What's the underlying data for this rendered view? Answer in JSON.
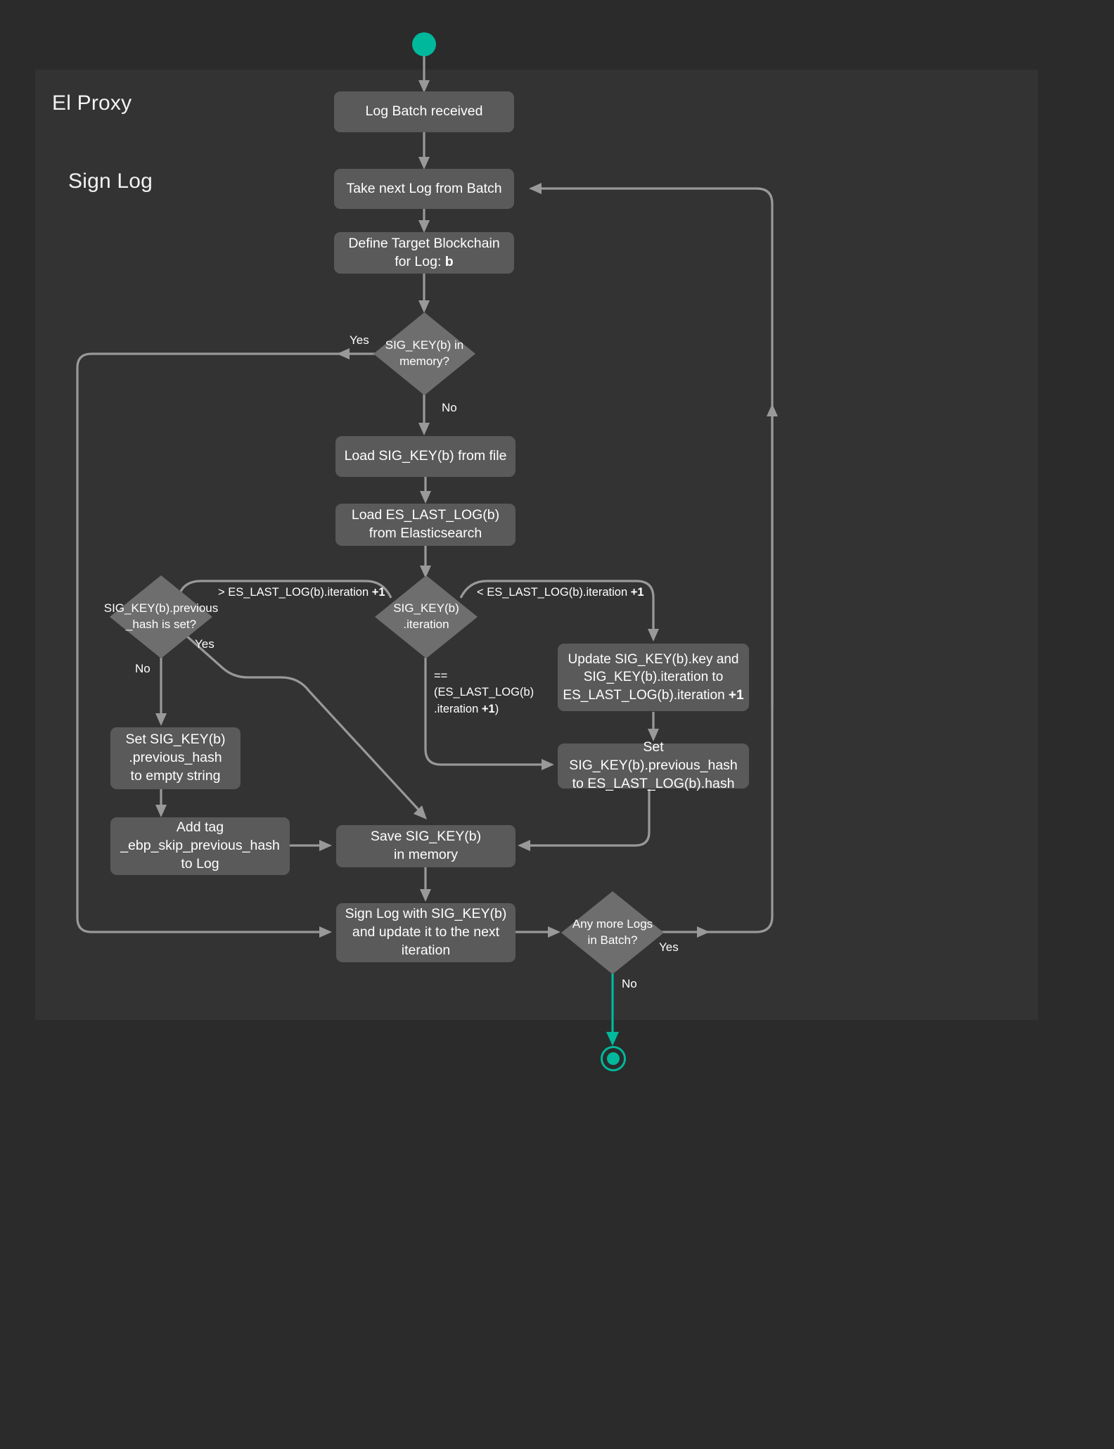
{
  "diagram": {
    "title": "El Proxy Sign Log flowchart",
    "colors": {
      "background": "#2b2b2b",
      "subgraph": "#333333",
      "node": "#5a5a5a",
      "diamond": "#6e6e6e",
      "edge": "#999999",
      "terminator": "#00b89c",
      "text": "#ffffff"
    },
    "subgraphs": [
      {
        "id": "el-proxy",
        "label": "El Proxy"
      },
      {
        "id": "sign-log",
        "label": "Sign Log"
      }
    ],
    "terminators": {
      "start": "start-node",
      "end": "end-node"
    },
    "nodes": [
      {
        "id": "log-batch-received",
        "label": "Log Batch received"
      },
      {
        "id": "take-next-log",
        "label": "Take next Log from Batch"
      },
      {
        "id": "define-target",
        "label": "Define Target Blockchain\nfor Log: b"
      },
      {
        "id": "load-sig-key",
        "label": "Load SIG_KEY(b) from file"
      },
      {
        "id": "load-es-last-log",
        "label": "Load ES_LAST_LOG(b)\nfrom Elasticsearch"
      },
      {
        "id": "update-sig-key",
        "label": "Update SIG_KEY(b).key and\nSIG_KEY(b).iteration to\nES_LAST_LOG(b).iteration +1"
      },
      {
        "id": "set-prev-hash-empty",
        "label": "Set SIG_KEY(b)\n.previous_hash\nto empty string"
      },
      {
        "id": "set-prev-hash-es",
        "label": "Set SIG_KEY(b).previous_hash\nto ES_LAST_LOG(b).hash"
      },
      {
        "id": "add-tag",
        "label": "Add tag\n_ebp_skip_previous_hash\nto Log"
      },
      {
        "id": "save-sig-key",
        "label": "Save SIG_KEY(b)\nin memory"
      },
      {
        "id": "sign-log-node",
        "label": "Sign Log with SIG_KEY(b)\nand update it to the next\niteration"
      }
    ],
    "decisions": [
      {
        "id": "sig-key-in-memory",
        "label": "SIG_KEY(b) in\nmemory?"
      },
      {
        "id": "prev-hash-is-set",
        "label": "SIG_KEY(b).previous\n_hash is set?"
      },
      {
        "id": "sig-key-iteration",
        "label": "SIG_KEY(b)\n.iteration"
      },
      {
        "id": "any-more-logs",
        "label": "Any more Logs\nin Batch?"
      }
    ],
    "edge_labels": {
      "memory_yes": "Yes",
      "memory_no": "No",
      "iteration_greater": "> ES_LAST_LOG(b).iteration +1",
      "iteration_less": "< ES_LAST_LOG(b).iteration +1",
      "iteration_equal": "==\n(ES_LAST_LOG(b)\n.iteration +1)",
      "prev_hash_yes": "Yes",
      "prev_hash_no": "No",
      "more_logs_yes": "Yes",
      "more_logs_no": "No"
    }
  }
}
